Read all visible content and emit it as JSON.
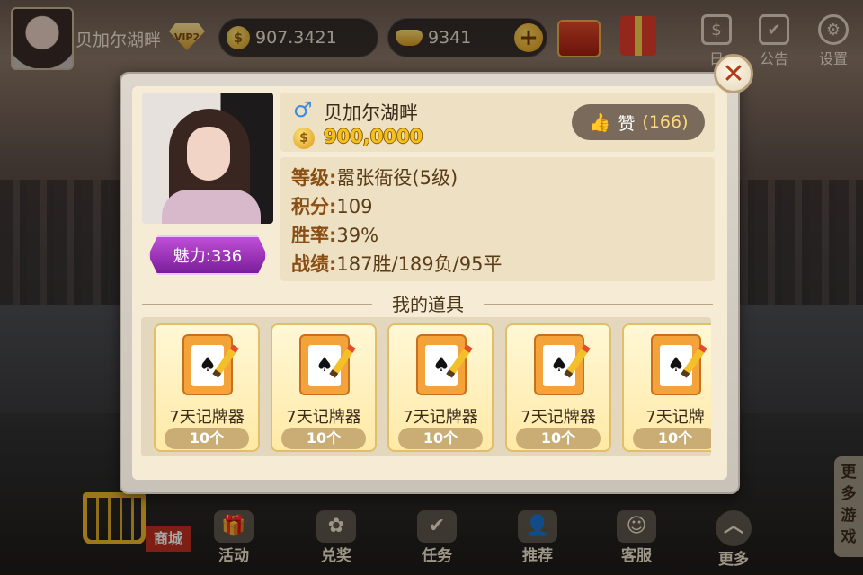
{
  "topbar": {
    "player_name": "贝加尔湖畔",
    "vip": "VIP2",
    "coins": "907.3421",
    "gold": "9341",
    "icons": [
      {
        "name": "sign-in",
        "label": "日",
        "glyph": "$"
      },
      {
        "name": "notice",
        "label": "公告",
        "glyph": "✔"
      },
      {
        "name": "settings",
        "label": "设置",
        "glyph": "⚙"
      }
    ]
  },
  "profile": {
    "gender_symbol": "♂",
    "name": "贝加尔湖畔",
    "coins": "900,0000",
    "charm_label": "魅力:336",
    "like_label": "赞",
    "like_count": "(166)",
    "level_key": "等级:",
    "level_val": "嚣张衙役(5级)",
    "score_key": "积分:",
    "score_val": "109",
    "winrate_key": "胜率:",
    "winrate_val": "39%",
    "record_key": "战绩:",
    "record_val": "187胜/189负/95平",
    "close_glyph": "✕"
  },
  "items_section": {
    "title": "我的道具",
    "items": [
      {
        "name": "7天记牌器",
        "qty": "10个"
      },
      {
        "name": "7天记牌器",
        "qty": "10个"
      },
      {
        "name": "7天记牌器",
        "qty": "10个"
      },
      {
        "name": "7天记牌器",
        "qty": "10个"
      },
      {
        "name": "7天记牌",
        "qty": "10个"
      }
    ]
  },
  "bottombar": {
    "shop": "商城",
    "items": [
      {
        "label": "活动",
        "glyph": "🎁"
      },
      {
        "label": "兑奖",
        "glyph": "✿"
      },
      {
        "label": "任务",
        "glyph": "✔"
      },
      {
        "label": "推荐",
        "glyph": "👤"
      },
      {
        "label": "客服",
        "glyph": "☺"
      },
      {
        "label": "更多",
        "glyph": "︿"
      }
    ],
    "more_games": "更多游戏"
  }
}
